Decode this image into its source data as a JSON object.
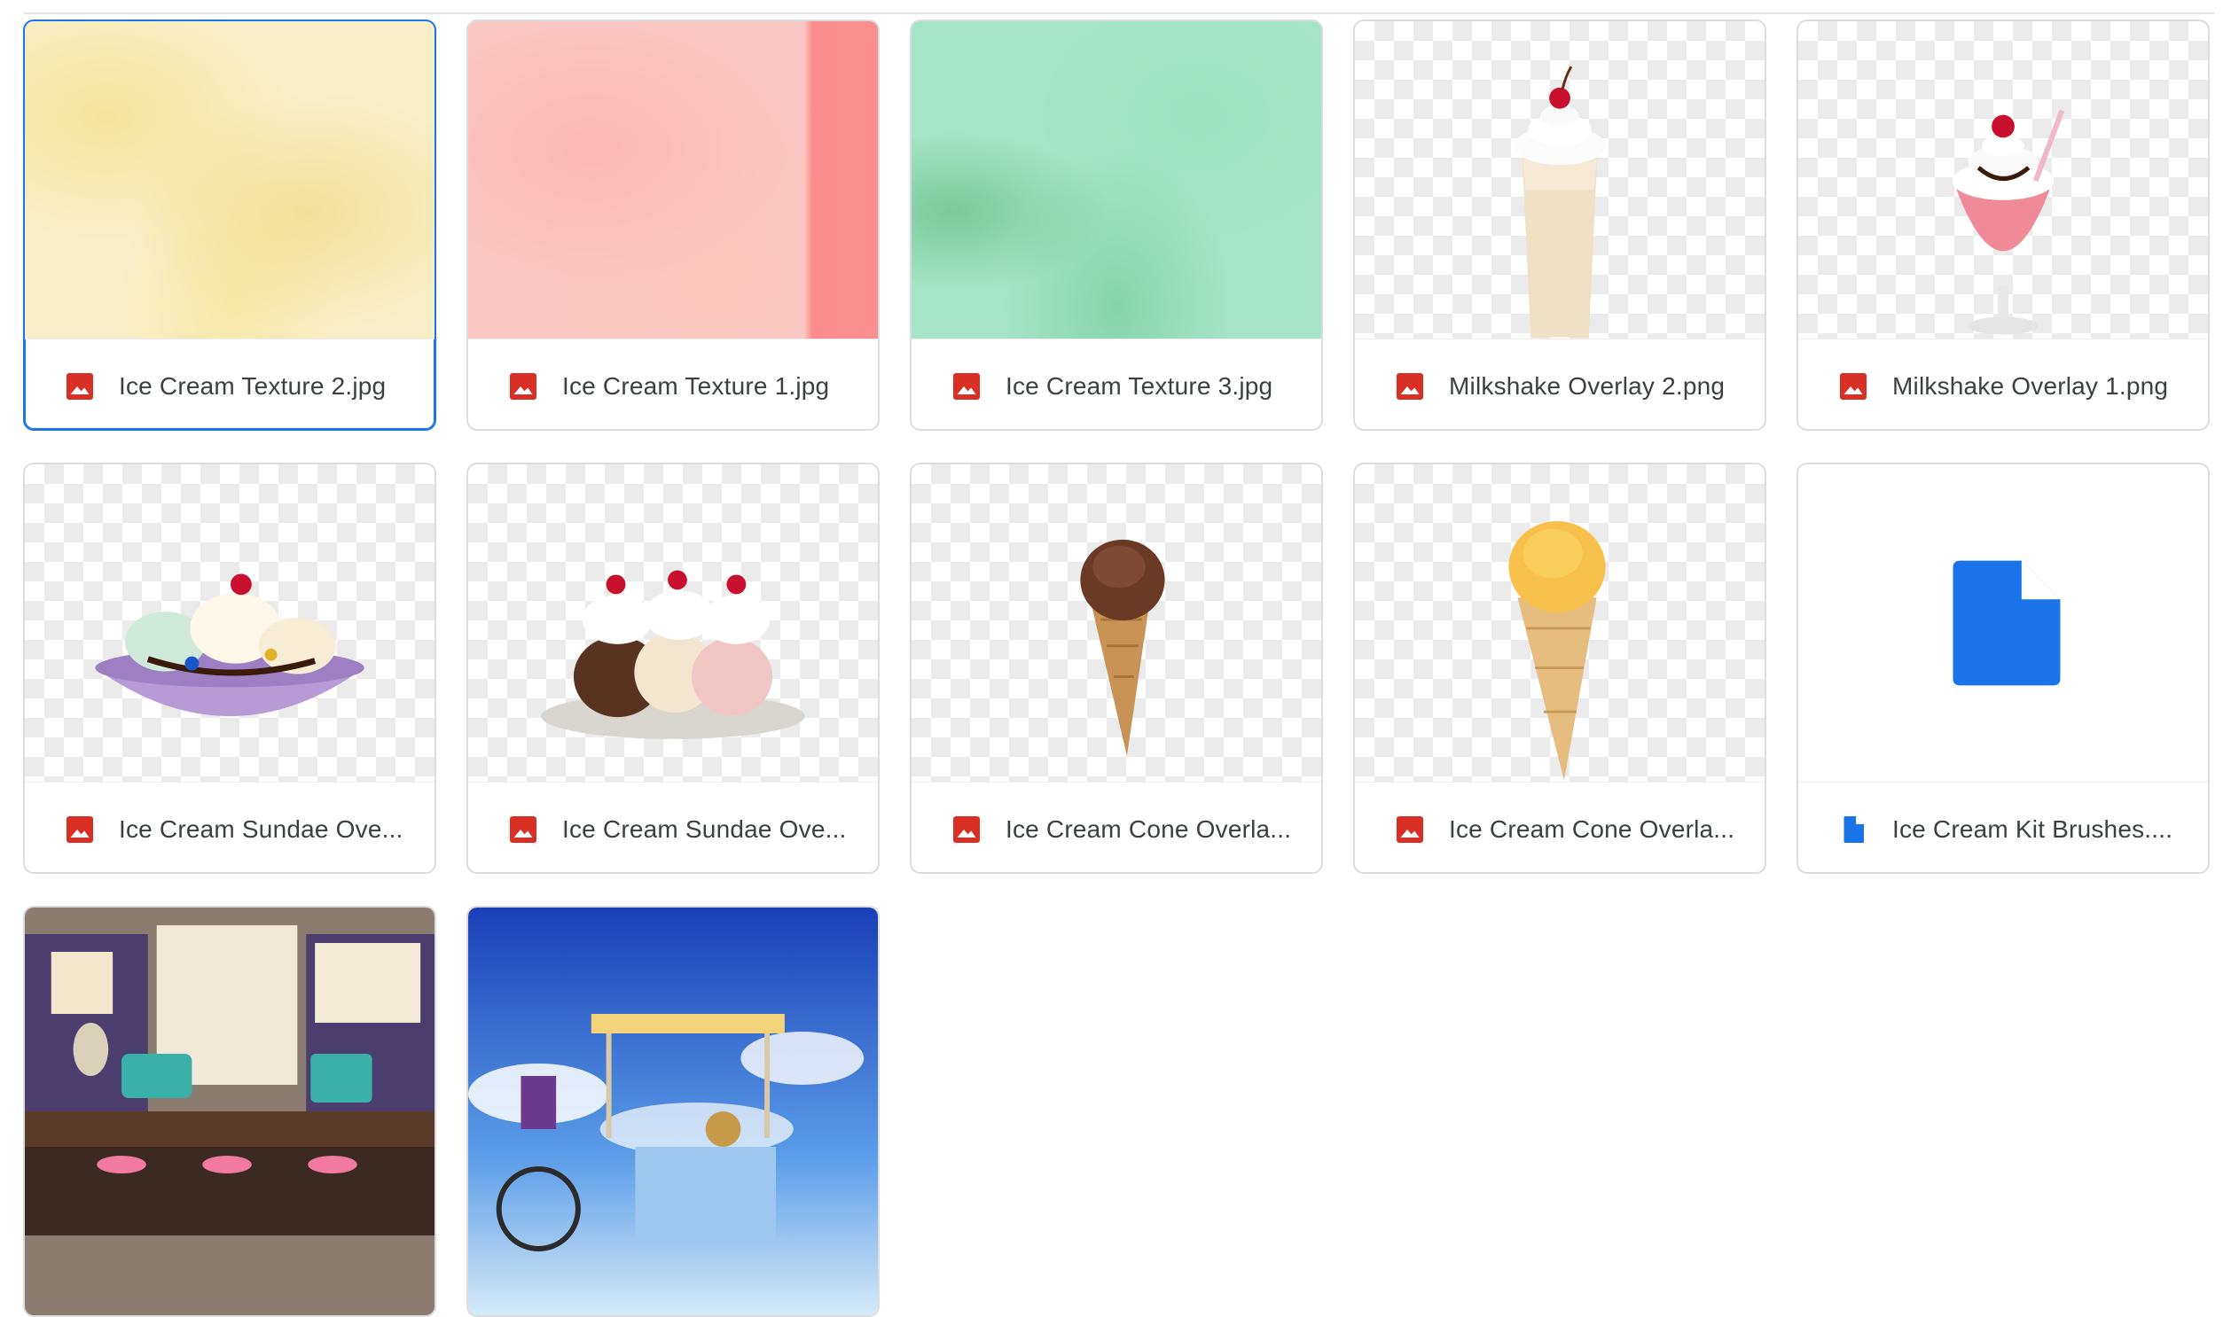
{
  "files": [
    {
      "name": "Ice Cream Texture 2.jpg",
      "type": "image",
      "selected": true
    },
    {
      "name": "Ice Cream Texture 1.jpg",
      "type": "image"
    },
    {
      "name": "Ice Cream Texture 3.jpg",
      "type": "image"
    },
    {
      "name": "Milkshake Overlay 2.png",
      "type": "image"
    },
    {
      "name": "Milkshake Overlay 1.png",
      "type": "image"
    },
    {
      "name": "Ice Cream Sundae Ove...",
      "type": "image"
    },
    {
      "name": "Ice Cream Sundae Ove...",
      "type": "image"
    },
    {
      "name": "Ice Cream Cone Overla...",
      "type": "image"
    },
    {
      "name": "Ice Cream Cone Overla...",
      "type": "image"
    },
    {
      "name": "Ice Cream Kit Brushes....",
      "type": "file"
    },
    {
      "name": "",
      "type": "image"
    },
    {
      "name": "",
      "type": "image"
    }
  ],
  "colors": {
    "image_icon": "#d93025",
    "file_icon": "#1a73e8",
    "selected_border": "#1a73e8"
  },
  "icons": {
    "image": "image-file-icon",
    "file": "generic-file-icon"
  }
}
